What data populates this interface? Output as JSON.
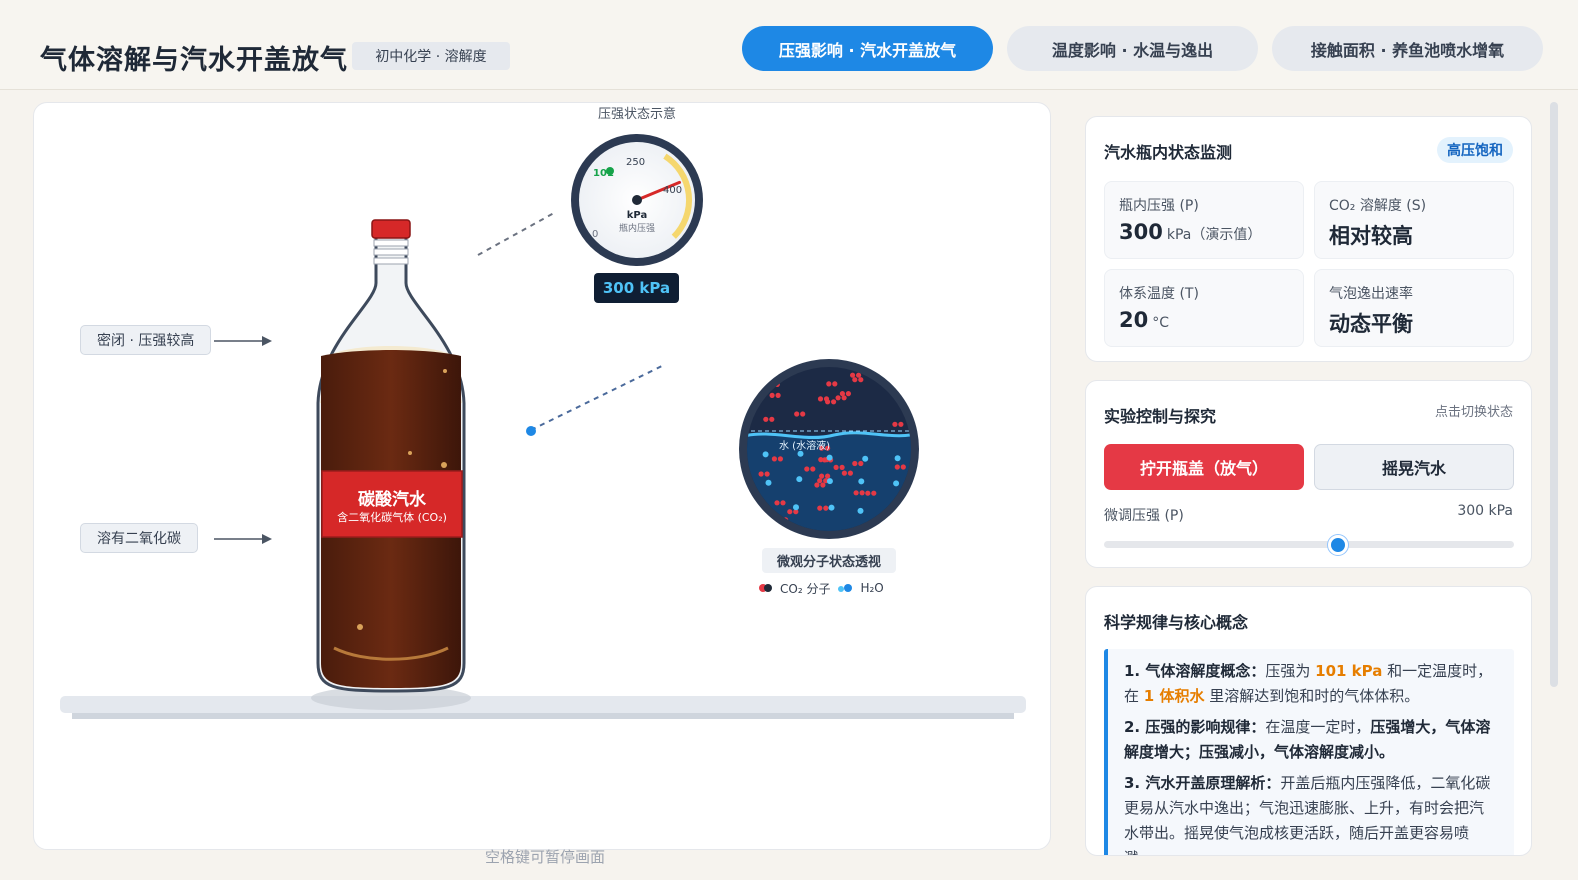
{
  "header": {
    "title": "气体溶解与汽水开盖放气",
    "subject_badge": "初中化学 · 溶解度",
    "tabs": [
      {
        "label": "压强影响 · 汽水开盖放气",
        "active": true
      },
      {
        "label": "温度影响 · 水温与逸出",
        "active": false
      },
      {
        "label": "接触面积 · 养鱼池喷水增氧",
        "active": false
      }
    ]
  },
  "stage": {
    "label_sealed": "密闭 · 压强较高",
    "label_dissolved": "溶有二氧化碳",
    "bottle_label_main": "碳酸汽水",
    "bottle_label_sub": "含二氧化碳气体 (CO₂)",
    "gauge": {
      "caption": "压强状态示意",
      "unit": "kPa",
      "sublabel": "瓶内压强",
      "ticks": [
        "0",
        "101",
        "250",
        "400"
      ],
      "value_kpa": 300,
      "max_kpa": 400,
      "readout": "300 kPa"
    },
    "micro": {
      "caption": "微观分子状态透视",
      "water_label": "水 (水溶液)",
      "legend_co2": "CO₂ 分子",
      "legend_h2o": "H₂O"
    },
    "pause_hint": "空格键可暂停画面"
  },
  "monitor": {
    "title": "汽水瓶内状态监测",
    "status_badge": "高压饱和",
    "metrics": [
      {
        "label": "瓶内压强 (P)",
        "value": "300",
        "unit": "kPa（演示值）"
      },
      {
        "label": "CO₂ 溶解度 (S)",
        "value": "相对较高",
        "unit": ""
      },
      {
        "label": "体系温度 (T)",
        "value": "20",
        "unit": "°C"
      },
      {
        "label": "气泡逸出速率",
        "value": "动态平衡",
        "unit": ""
      }
    ]
  },
  "controls": {
    "title": "实验控制与探究",
    "hint": "点击切换状态",
    "open_button": "拧开瓶盖（放气）",
    "shake_button": "摇晃汽水",
    "slider_label": "微调压强 (P)",
    "slider_value": "300 kPa",
    "slider_fraction": 0.57
  },
  "concepts": {
    "title": "科学规律与核心概念",
    "c1_head": "1. 气体溶解度概念：",
    "c1_a": "压强为 ",
    "c1_hl1": "101 kPa",
    "c1_b": " 和一定温度时，在 ",
    "c1_hl2": "1 体积水",
    "c1_c": " 里溶解达到饱和时的气体体积。",
    "c2_head": "2. 压强的影响规律：",
    "c2_a": "在温度一定时，",
    "c2_b1": "压强增大，气体溶解度增大；压强减小，气体溶解度减小。",
    "c3_head": "3. 汽水开盖原理解析：",
    "c3_text": "开盖后瓶内压强降低，二氧化碳更易从汽水中逸出；气泡迅速膨胀、上升，有时会把汽水带出。摇晃使气泡成核更活跃，随后开盖更容易喷溅。"
  }
}
